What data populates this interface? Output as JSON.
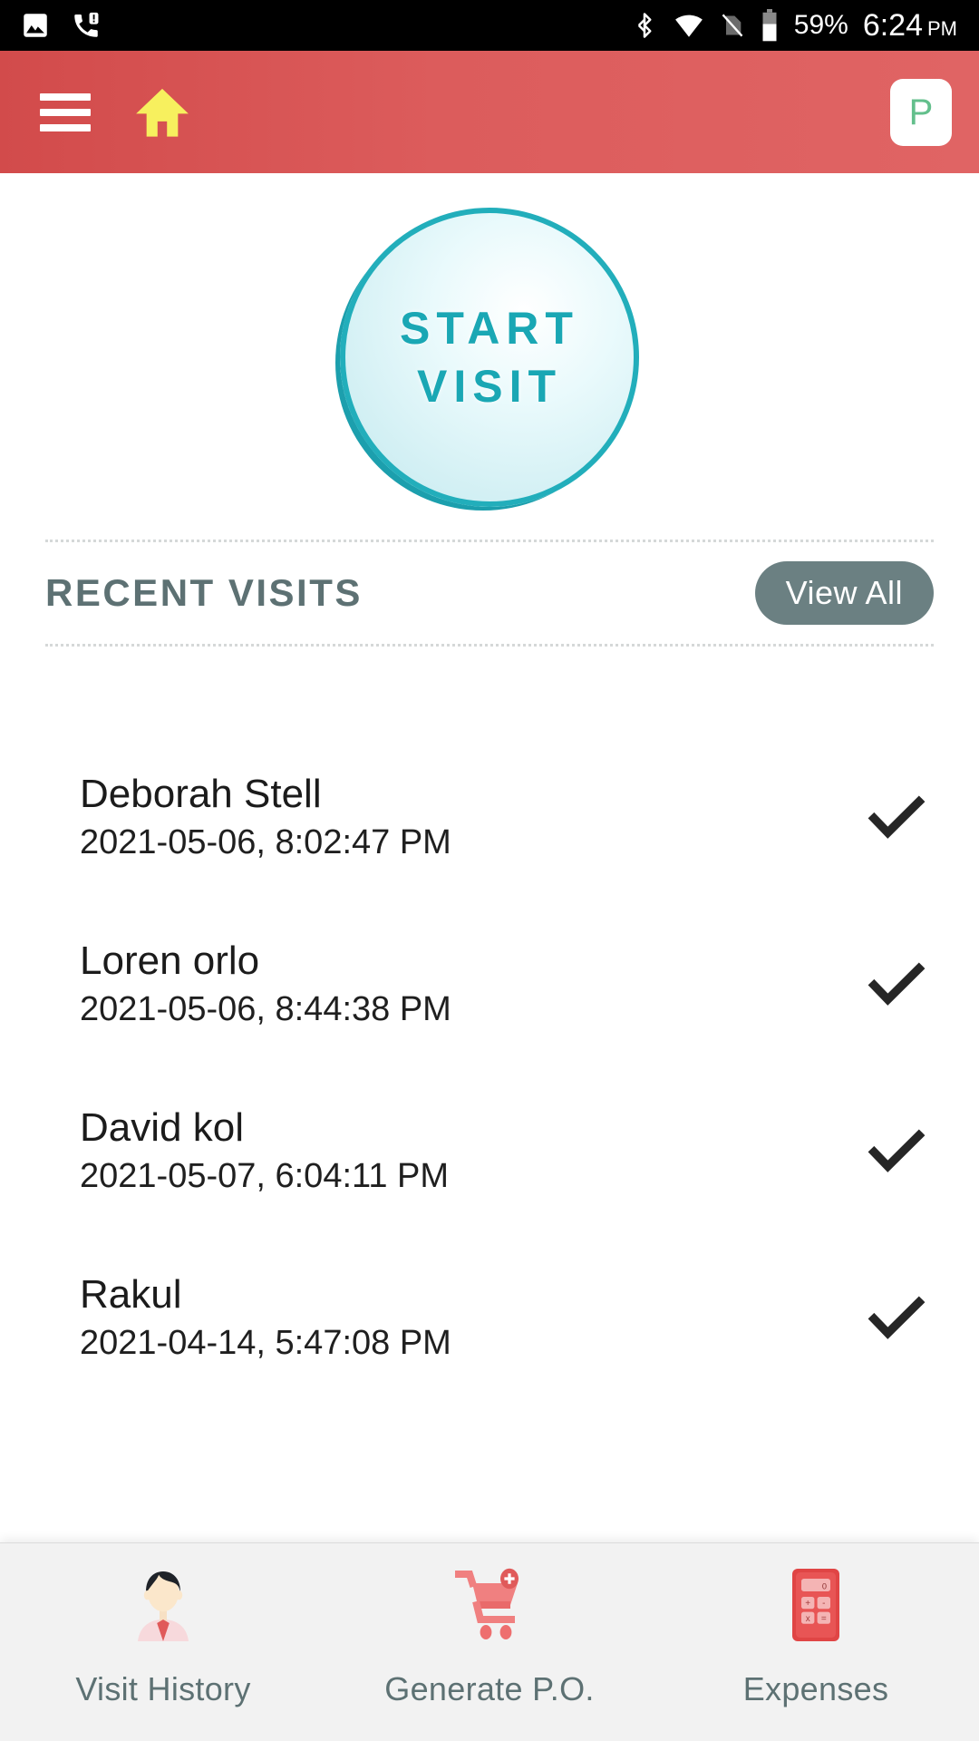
{
  "statusbar": {
    "icons_left": [
      "image-icon",
      "phone-missed-icon"
    ],
    "icons_right": [
      "bluetooth-icon",
      "wifi-icon",
      "sim-off-icon",
      "battery-icon"
    ],
    "battery_percent": "59%",
    "time": "6:24",
    "ampm": "PM"
  },
  "appbar": {
    "menu_icon": "hamburger-menu-icon",
    "home_icon": "home-icon",
    "profile_initial": "P",
    "background_color": "#dc5c5c",
    "home_icon_color": "#f7f05e",
    "profile_text_color": "#63bf8c"
  },
  "main": {
    "start_visit": {
      "line1": "START",
      "line2": "VISIT",
      "text_color": "#1aa7b4",
      "ring_color": "#22aebb"
    },
    "recent": {
      "title": "RECENT VISITS",
      "view_all_label": "View All",
      "view_all_color": "#6b8082"
    },
    "visits": [
      {
        "name": "Deborah Stell",
        "timestamp": "2021-05-06, 8:02:47 PM",
        "status_icon": "check-icon"
      },
      {
        "name": "Loren orlo",
        "timestamp": "2021-05-06, 8:44:38 PM",
        "status_icon": "check-icon"
      },
      {
        "name": "David kol",
        "timestamp": "2021-05-07, 6:04:11 PM",
        "status_icon": "check-icon"
      },
      {
        "name": "Rakul",
        "timestamp": "2021-04-14, 5:47:08 PM",
        "status_icon": "check-icon"
      }
    ]
  },
  "bottomnav": {
    "items": [
      {
        "label": "Visit History",
        "icon": "person-avatar-icon"
      },
      {
        "label": "Generate P.O.",
        "icon": "shopping-cart-plus-icon"
      },
      {
        "label": "Expenses",
        "icon": "calculator-icon"
      }
    ],
    "label_color": "#5d7173"
  }
}
